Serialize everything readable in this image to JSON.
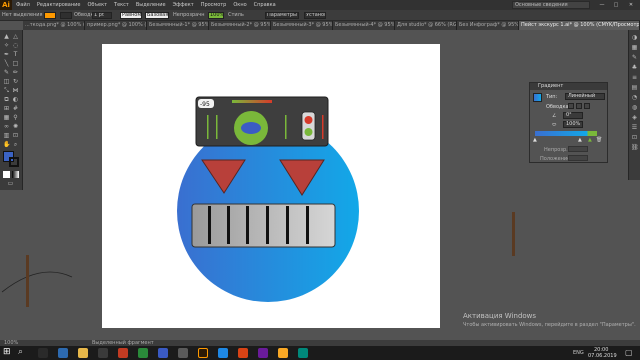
{
  "app": {
    "logo": "Ai"
  },
  "menu": {
    "items": [
      "Файл",
      "Редактирование",
      "Объект",
      "Текст",
      "Выделение",
      "Эффект",
      "Просмотр",
      "Окно",
      "Справка"
    ],
    "workspace": "Основные сведения",
    "window_controls": [
      "—",
      "□",
      "✕"
    ]
  },
  "control_bar": {
    "selection": "Нет выделения",
    "stroke_label": "Обводка",
    "stroke_value": "1 pt",
    "brush_label": "Равномерно",
    "profile_label": "Базовая",
    "opacity_label": "Непрозрачн",
    "opacity_value": "100%",
    "style_label": "Стиль",
    "doc_params": "Параметры документа",
    "prefs": "Установки"
  },
  "tabs": [
    "...ткода.png* @ 100% (RGB/...",
    "пример.png* @ 100% (RGB/Пр...",
    "Безымянный-1* @ 95% (CMYK/...",
    "Безымянный-2* @ 95% (CMYK/...",
    "Безымянный-3* @ 95% (CMYK/...",
    "Безымянный-4* @ 95% (CMYK/...",
    "Для studio* @ 66% (RGB/Просм...",
    "Без Инфограф* @ 95% (CMYK/...",
    "Пейст экскурс 1.ai* @ 100% (CMYK/Просмотр)"
  ],
  "gradient_panel": {
    "title": "Градиент",
    "type_label": "Тип:",
    "type_value": "Линейный",
    "stroke_label": "Обводка:",
    "angle_value": "0°",
    "aspect_value": "100%",
    "opacity_label": "Непрозр.:",
    "location_label": "Положение:"
  },
  "artwork": {
    "counter_value": "-95"
  },
  "status": {
    "zoom": "100%",
    "tool": "Выделенный фрагмент"
  },
  "watermark": {
    "line1": "Активация Windows",
    "line2": "Чтобы активировать Windows, перейдите в раздел \"Параметры\"."
  },
  "taskbar": {
    "time": "20:00",
    "date": "07.06.2019",
    "lang": "ENG"
  },
  "colors": {
    "circle_left": "#3a6fd0",
    "circle_right": "#12a8e8",
    "triangle": "#b8403a",
    "panel_dark": "#3e3e3e",
    "accent_green": "#7ab83a"
  }
}
